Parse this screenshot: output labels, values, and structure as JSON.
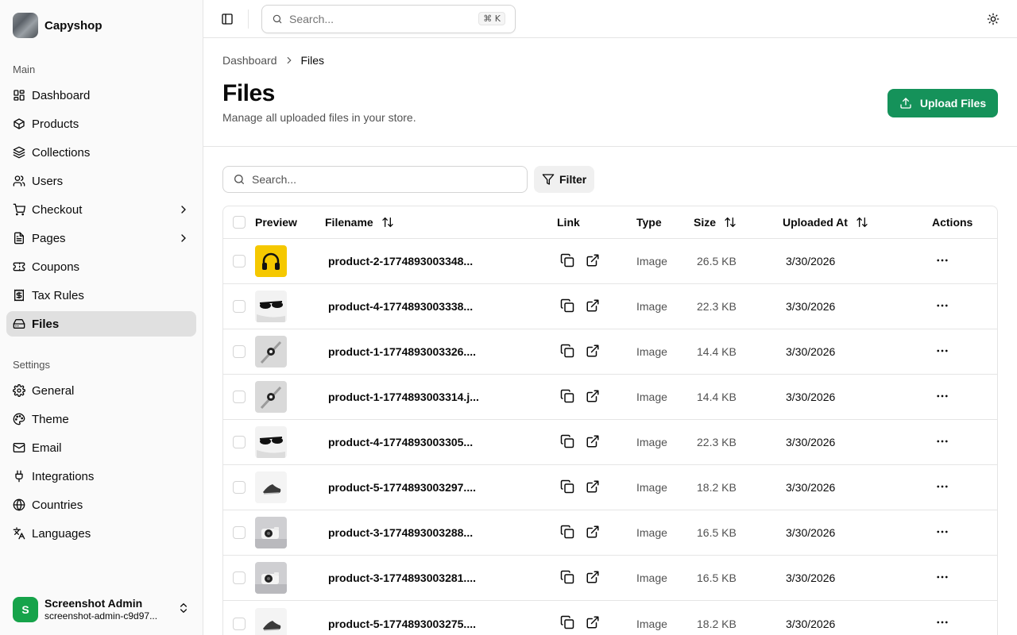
{
  "brand": {
    "name": "Capyshop"
  },
  "sidebar": {
    "main_label": "Main",
    "main_items": [
      {
        "label": "Dashboard",
        "icon": "dashboard-icon"
      },
      {
        "label": "Products",
        "icon": "package-icon"
      },
      {
        "label": "Collections",
        "icon": "layers-icon"
      },
      {
        "label": "Users",
        "icon": "users-icon"
      },
      {
        "label": "Checkout",
        "icon": "cart-icon",
        "expandable": true
      },
      {
        "label": "Pages",
        "icon": "file-text-icon",
        "expandable": true
      },
      {
        "label": "Coupons",
        "icon": "ticket-icon"
      },
      {
        "label": "Tax Rules",
        "icon": "receipt-icon"
      },
      {
        "label": "Files",
        "icon": "hard-drive-icon",
        "active": true
      }
    ],
    "settings_label": "Settings",
    "settings_items": [
      {
        "label": "General",
        "icon": "gear-icon"
      },
      {
        "label": "Theme",
        "icon": "palette-icon"
      },
      {
        "label": "Email",
        "icon": "mail-icon"
      },
      {
        "label": "Integrations",
        "icon": "plug-icon"
      },
      {
        "label": "Countries",
        "icon": "globe-icon"
      },
      {
        "label": "Languages",
        "icon": "languages-icon"
      }
    ],
    "user": {
      "initial": "S",
      "name": "Screenshot Admin",
      "email": "screenshot-admin-c9d97..."
    }
  },
  "topbar": {
    "search_placeholder": "Search...",
    "shortcut": "⌘ K"
  },
  "breadcrumb": {
    "parent": "Dashboard",
    "current": "Files"
  },
  "page": {
    "title": "Files",
    "subtitle": "Manage all uploaded files in your store.",
    "upload_label": "Upload Files"
  },
  "table": {
    "search_placeholder": "Search...",
    "filter_label": "Filter",
    "headers": {
      "preview": "Preview",
      "filename": "Filename",
      "link": "Link",
      "type": "Type",
      "size": "Size",
      "uploaded": "Uploaded At",
      "actions": "Actions"
    },
    "rows": [
      {
        "filename": "product-2-1774893003348...",
        "type": "Image",
        "size": "26.5 KB",
        "uploaded": "3/30/2026",
        "thumb": "headphones"
      },
      {
        "filename": "product-4-1774893003338...",
        "type": "Image",
        "size": "22.3 KB",
        "uploaded": "3/30/2026",
        "thumb": "sunglasses"
      },
      {
        "filename": "product-1-1774893003326....",
        "type": "Image",
        "size": "14.4 KB",
        "uploaded": "3/30/2026",
        "thumb": "watch"
      },
      {
        "filename": "product-1-1774893003314.j...",
        "type": "Image",
        "size": "14.4 KB",
        "uploaded": "3/30/2026",
        "thumb": "watch"
      },
      {
        "filename": "product-4-1774893003305...",
        "type": "Image",
        "size": "22.3 KB",
        "uploaded": "3/30/2026",
        "thumb": "sunglasses"
      },
      {
        "filename": "product-5-1774893003297....",
        "type": "Image",
        "size": "18.2 KB",
        "uploaded": "3/30/2026",
        "thumb": "shoe"
      },
      {
        "filename": "product-3-1774893003288...",
        "type": "Image",
        "size": "16.5 KB",
        "uploaded": "3/30/2026",
        "thumb": "camera"
      },
      {
        "filename": "product-3-1774893003281....",
        "type": "Image",
        "size": "16.5 KB",
        "uploaded": "3/30/2026",
        "thumb": "camera"
      },
      {
        "filename": "product-5-1774893003275....",
        "type": "Image",
        "size": "18.2 KB",
        "uploaded": "3/30/2026",
        "thumb": "shoe"
      }
    ]
  },
  "colors": {
    "accent": "#15925a",
    "active_nav": "#e0e0e0",
    "avatar": "#16a34a"
  }
}
